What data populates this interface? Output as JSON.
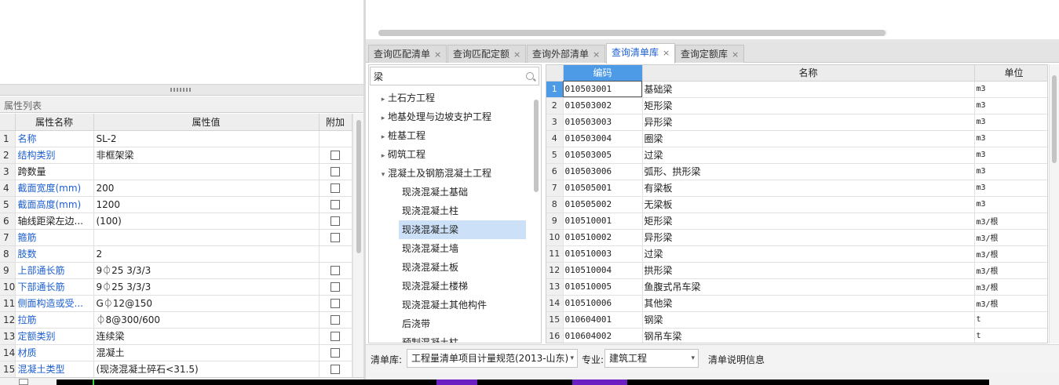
{
  "property_panel": {
    "title": "属性列表",
    "headers": {
      "index": "",
      "name": "属性名称",
      "value": "属性值",
      "extra": "附加"
    },
    "rows": [
      {
        "idx": "1",
        "name": "名称",
        "value": "SL-2",
        "blue": true,
        "checkbox": false
      },
      {
        "idx": "2",
        "name": "结构类别",
        "value": "非框架梁",
        "blue": true,
        "checkbox": true
      },
      {
        "idx": "3",
        "name": "跨数量",
        "value": "",
        "blue": false,
        "checkbox": true
      },
      {
        "idx": "4",
        "name": "截面宽度(mm)",
        "value": "200",
        "blue": true,
        "checkbox": true
      },
      {
        "idx": "5",
        "name": "截面高度(mm)",
        "value": "1200",
        "blue": true,
        "checkbox": true
      },
      {
        "idx": "6",
        "name": "轴线距梁左边...",
        "value": "(100)",
        "blue": false,
        "checkbox": true
      },
      {
        "idx": "7",
        "name": "箍筋",
        "value": "",
        "blue": true,
        "checkbox": true
      },
      {
        "idx": "8",
        "name": "肢数",
        "value": "2",
        "blue": true,
        "checkbox": false
      },
      {
        "idx": "9",
        "name": "上部通长筋",
        "value": "9⏀25 3/3/3",
        "blue": true,
        "checkbox": true
      },
      {
        "idx": "10",
        "name": "下部通长筋",
        "value": "9⏀25 3/3/3",
        "blue": true,
        "checkbox": true
      },
      {
        "idx": "11",
        "name": "侧面构造或受...",
        "value": "G⏀12@150",
        "blue": true,
        "checkbox": true
      },
      {
        "idx": "12",
        "name": "拉筋",
        "value": "⏀8@300/600",
        "blue": true,
        "checkbox": true
      },
      {
        "idx": "13",
        "name": "定额类别",
        "value": "连续梁",
        "blue": true,
        "checkbox": true
      },
      {
        "idx": "14",
        "name": "材质",
        "value": "混凝土",
        "blue": true,
        "checkbox": true
      },
      {
        "idx": "15",
        "name": "混凝土类型",
        "value": "(现浇混凝土碎石<31.5)",
        "blue": true,
        "checkbox": true
      }
    ]
  },
  "tabs": [
    {
      "label": "查询匹配清单",
      "close": "×",
      "active": false
    },
    {
      "label": "查询匹配定额",
      "close": "×",
      "active": false
    },
    {
      "label": "查询外部清单",
      "close": "×",
      "active": false
    },
    {
      "label": "查询清单库",
      "close": "×",
      "active": true
    },
    {
      "label": "查询定额库",
      "close": "×",
      "active": false
    }
  ],
  "search": {
    "value": "梁",
    "placeholder": ""
  },
  "tree": [
    {
      "label": "土石方工程",
      "level": 0,
      "arrow": "▸",
      "selected": false
    },
    {
      "label": "地基处理与边坡支护工程",
      "level": 0,
      "arrow": "▸",
      "selected": false
    },
    {
      "label": "桩基工程",
      "level": 0,
      "arrow": "▸",
      "selected": false
    },
    {
      "label": "砌筑工程",
      "level": 0,
      "arrow": "▸",
      "selected": false
    },
    {
      "label": "混凝土及钢筋混凝土工程",
      "level": 0,
      "arrow": "▾",
      "selected": false
    },
    {
      "label": "现浇混凝土基础",
      "level": 1,
      "arrow": "",
      "selected": false
    },
    {
      "label": "现浇混凝土柱",
      "level": 1,
      "arrow": "",
      "selected": false
    },
    {
      "label": "现浇混凝土梁",
      "level": 1,
      "arrow": "",
      "selected": true
    },
    {
      "label": "现浇混凝土墙",
      "level": 1,
      "arrow": "",
      "selected": false
    },
    {
      "label": "现浇混凝土板",
      "level": 1,
      "arrow": "",
      "selected": false
    },
    {
      "label": "现浇混凝土楼梯",
      "level": 1,
      "arrow": "",
      "selected": false
    },
    {
      "label": "现浇混凝土其他构件",
      "level": 1,
      "arrow": "",
      "selected": false
    },
    {
      "label": "后浇带",
      "level": 1,
      "arrow": "",
      "selected": false
    },
    {
      "label": "预制混凝土柱",
      "level": 1,
      "arrow": "",
      "selected": false
    }
  ],
  "grid": {
    "headers": {
      "index": "",
      "code": "编码",
      "name": "名称",
      "unit": "单位"
    },
    "rows": [
      {
        "idx": "1",
        "code": "010503001",
        "name": "基础梁",
        "unit": "m3"
      },
      {
        "idx": "2",
        "code": "010503002",
        "name": "矩形梁",
        "unit": "m3"
      },
      {
        "idx": "3",
        "code": "010503003",
        "name": "异形梁",
        "unit": "m3"
      },
      {
        "idx": "4",
        "code": "010503004",
        "name": "圈梁",
        "unit": "m3"
      },
      {
        "idx": "5",
        "code": "010503005",
        "name": "过梁",
        "unit": "m3"
      },
      {
        "idx": "6",
        "code": "010503006",
        "name": "弧形、拱形梁",
        "unit": "m3"
      },
      {
        "idx": "7",
        "code": "010505001",
        "name": "有梁板",
        "unit": "m3"
      },
      {
        "idx": "8",
        "code": "010505002",
        "name": "无梁板",
        "unit": "m3"
      },
      {
        "idx": "9",
        "code": "010510001",
        "name": "矩形梁",
        "unit": "m3/根"
      },
      {
        "idx": "10",
        "code": "010510002",
        "name": "异形梁",
        "unit": "m3/根"
      },
      {
        "idx": "11",
        "code": "010510003",
        "name": "过梁",
        "unit": "m3/根"
      },
      {
        "idx": "12",
        "code": "010510004",
        "name": "拱形梁",
        "unit": "m3/根"
      },
      {
        "idx": "13",
        "code": "010510005",
        "name": "鱼腹式吊车梁",
        "unit": "m3/根"
      },
      {
        "idx": "14",
        "code": "010510006",
        "name": "其他梁",
        "unit": "m3/根"
      },
      {
        "idx": "15",
        "code": "010604001",
        "name": "钢梁",
        "unit": "t"
      },
      {
        "idx": "16",
        "code": "010604002",
        "name": "钢吊车梁",
        "unit": "t"
      }
    ]
  },
  "footer": {
    "library_label": "清单库:",
    "library_value": "工程量清单项目计量规范(2013-山东)",
    "specialty_label": "专业:",
    "specialty_value": "建筑工程",
    "info_label": "清单说明信息"
  },
  "colors": {
    "accent": "#4d9be6",
    "link_blue": "#1d5fd0",
    "selection": "#cce0f7",
    "canvas_purple": "#6b1fc2"
  }
}
